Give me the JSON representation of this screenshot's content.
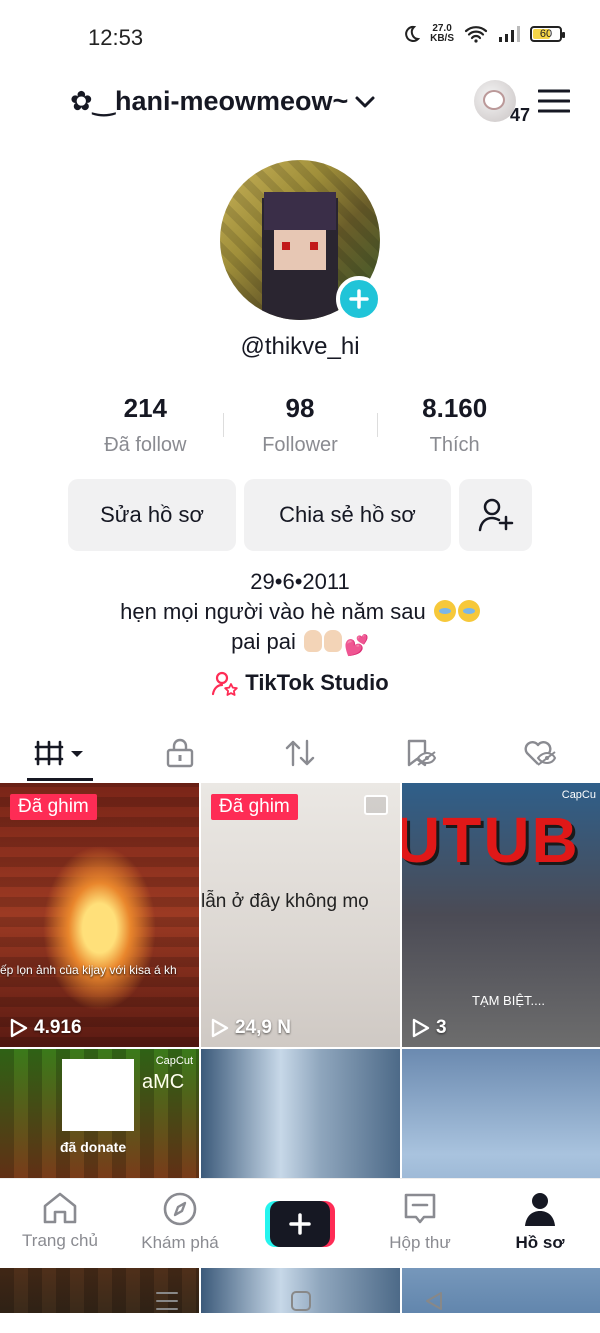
{
  "status_bar": {
    "time": "12:53",
    "net_speed_value": "27.0",
    "net_speed_unit": "KB/S",
    "battery": "60",
    "battery_level_percent": 60
  },
  "header": {
    "username": "✿‿hani-meowmeow~",
    "notification_count": "47"
  },
  "profile": {
    "handle": "@thikve_hi",
    "stats": [
      {
        "value": "214",
        "label": "Đã follow"
      },
      {
        "value": "98",
        "label": "Follower"
      },
      {
        "value": "8.160",
        "label": "Thích"
      }
    ],
    "edit_button": "Sửa hồ sơ",
    "share_button": "Chia sẻ hồ sơ",
    "bio_line1": "29•6•2011",
    "bio_line2": "hẹn mọi người vào hè năm sau",
    "bio_line3": "pai pai",
    "studio_link": "TikTok Studio"
  },
  "tabs": [
    {
      "icon": "videos-grid-icon",
      "active": true
    },
    {
      "icon": "lock-icon",
      "active": false
    },
    {
      "icon": "repost-icon",
      "active": false
    },
    {
      "icon": "favorites-hidden-icon",
      "active": false
    },
    {
      "icon": "liked-hidden-icon",
      "active": false
    }
  ],
  "videos": [
    {
      "pinned_label": "Đã ghim",
      "views": "4.916",
      "caption": "ếp lọn ảnh của kijay với kisa á kh"
    },
    {
      "pinned_label": "Đã ghim",
      "views": "24,9 N",
      "caption": "lẫn ở đây không mọ"
    },
    {
      "views": "3",
      "title": "UTUB CO-OP",
      "subtitle": "TẠM BIỆT....",
      "brand": "CapCu"
    },
    {
      "text": "đã donate",
      "banner": "aMC",
      "brand": "CapCut"
    },
    {},
    {}
  ],
  "bottom_nav": [
    {
      "label": "Trang chủ",
      "icon": "home-icon",
      "active": false
    },
    {
      "label": "Khám phá",
      "icon": "compass-icon",
      "active": false
    },
    {
      "label": "",
      "icon": "create-plus-icon",
      "active": false
    },
    {
      "label": "Hộp thư",
      "icon": "inbox-icon",
      "active": false
    },
    {
      "label": "Hồ sơ",
      "icon": "profile-icon",
      "active": true
    }
  ],
  "colors": {
    "accent_red": "#fe2c55",
    "accent_cyan": "#25f4ee",
    "plus_badge": "#20c4d8",
    "text_primary": "#161823",
    "text_secondary": "#8a8b91"
  }
}
